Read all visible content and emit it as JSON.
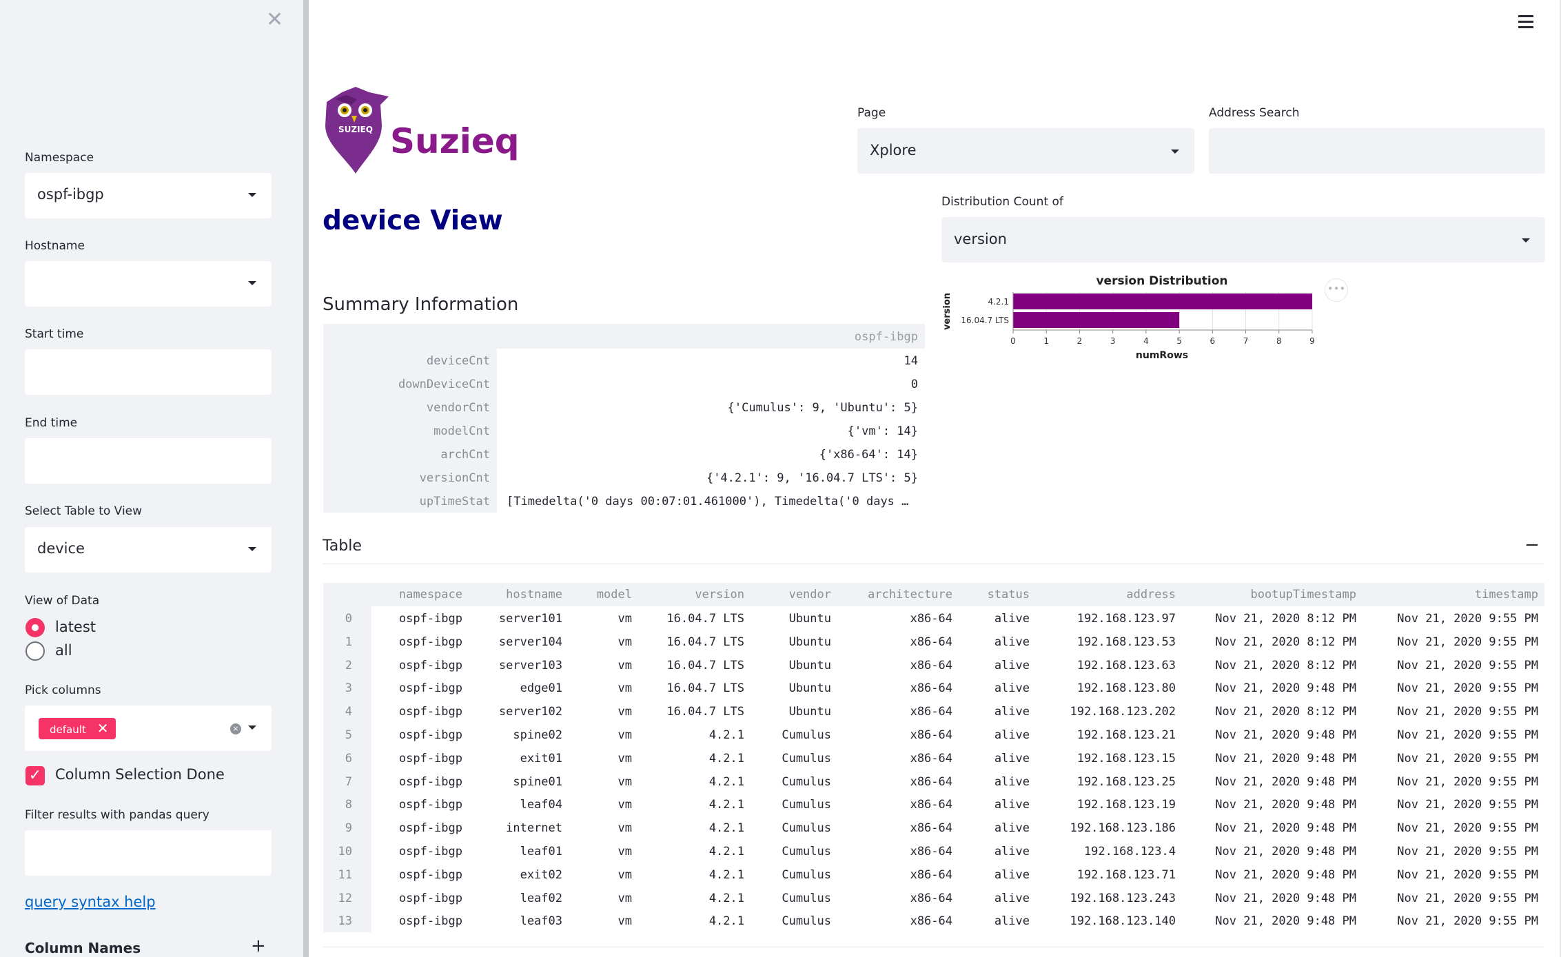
{
  "sidebar": {
    "namespace": {
      "label": "Namespace",
      "value": "ospf-ibgp"
    },
    "hostname": {
      "label": "Hostname",
      "value": ""
    },
    "start_time": {
      "label": "Start time",
      "value": ""
    },
    "end_time": {
      "label": "End time",
      "value": ""
    },
    "table_select": {
      "label": "Select Table to View",
      "value": "device"
    },
    "view_of_data": {
      "label": "View of Data",
      "options": [
        "latest",
        "all"
      ],
      "selected": "latest"
    },
    "pick_columns": {
      "label": "Pick columns",
      "tag": "default",
      "tag_close": "✕"
    },
    "column_selection_done": {
      "label": "Column Selection Done",
      "checked": true
    },
    "filter": {
      "label": "Filter results with pandas query",
      "value": ""
    },
    "query_help": "query syntax help",
    "column_names": {
      "label": "Column Names",
      "toggle": "+"
    }
  },
  "header": {
    "logo_text": "Suzieq",
    "logo_badge": "SUZIEQ",
    "page": {
      "label": "Page",
      "value": "Xplore"
    },
    "address_search": {
      "label": "Address Search",
      "value": ""
    }
  },
  "main": {
    "title": "device View",
    "distribution": {
      "label": "Distribution Count of",
      "value": "version"
    },
    "summary": {
      "heading": "Summary Information",
      "namespace": "ospf-ibgp",
      "rows": [
        {
          "key": "deviceCnt",
          "value": "14"
        },
        {
          "key": "downDeviceCnt",
          "value": "0"
        },
        {
          "key": "vendorCnt",
          "value": "{'Cumulus': 9, 'Ubuntu': 5}"
        },
        {
          "key": "modelCnt",
          "value": "{'vm': 14}"
        },
        {
          "key": "archCnt",
          "value": "{'x86-64': 14}"
        },
        {
          "key": "versionCnt",
          "value": "{'4.2.1': 9, '16.04.7 LTS': 5}"
        },
        {
          "key": "upTimeStat",
          "value": "[Timedelta('0 days 00:07:01.461000'), Timedelta('0 days …"
        }
      ]
    },
    "table": {
      "heading": "Table",
      "collapse": "−",
      "columns": [
        "namespace",
        "hostname",
        "model",
        "version",
        "vendor",
        "architecture",
        "status",
        "address",
        "bootupTimestamp",
        "timestamp"
      ],
      "rows": [
        [
          "0",
          "ospf-ibgp",
          "server101",
          "vm",
          "16.04.7 LTS",
          "Ubuntu",
          "x86-64",
          "alive",
          "192.168.123.97",
          "Nov 21, 2020 8:12 PM",
          "Nov 21, 2020 9:55 PM"
        ],
        [
          "1",
          "ospf-ibgp",
          "server104",
          "vm",
          "16.04.7 LTS",
          "Ubuntu",
          "x86-64",
          "alive",
          "192.168.123.53",
          "Nov 21, 2020 8:12 PM",
          "Nov 21, 2020 9:55 PM"
        ],
        [
          "2",
          "ospf-ibgp",
          "server103",
          "vm",
          "16.04.7 LTS",
          "Ubuntu",
          "x86-64",
          "alive",
          "192.168.123.63",
          "Nov 21, 2020 8:12 PM",
          "Nov 21, 2020 9:55 PM"
        ],
        [
          "3",
          "ospf-ibgp",
          "edge01",
          "vm",
          "16.04.7 LTS",
          "Ubuntu",
          "x86-64",
          "alive",
          "192.168.123.80",
          "Nov 21, 2020 9:48 PM",
          "Nov 21, 2020 9:55 PM"
        ],
        [
          "4",
          "ospf-ibgp",
          "server102",
          "vm",
          "16.04.7 LTS",
          "Ubuntu",
          "x86-64",
          "alive",
          "192.168.123.202",
          "Nov 21, 2020 8:12 PM",
          "Nov 21, 2020 9:55 PM"
        ],
        [
          "5",
          "ospf-ibgp",
          "spine02",
          "vm",
          "4.2.1",
          "Cumulus",
          "x86-64",
          "alive",
          "192.168.123.21",
          "Nov 21, 2020 9:48 PM",
          "Nov 21, 2020 9:55 PM"
        ],
        [
          "6",
          "ospf-ibgp",
          "exit01",
          "vm",
          "4.2.1",
          "Cumulus",
          "x86-64",
          "alive",
          "192.168.123.15",
          "Nov 21, 2020 9:48 PM",
          "Nov 21, 2020 9:55 PM"
        ],
        [
          "7",
          "ospf-ibgp",
          "spine01",
          "vm",
          "4.2.1",
          "Cumulus",
          "x86-64",
          "alive",
          "192.168.123.25",
          "Nov 21, 2020 9:48 PM",
          "Nov 21, 2020 9:55 PM"
        ],
        [
          "8",
          "ospf-ibgp",
          "leaf04",
          "vm",
          "4.2.1",
          "Cumulus",
          "x86-64",
          "alive",
          "192.168.123.19",
          "Nov 21, 2020 9:48 PM",
          "Nov 21, 2020 9:55 PM"
        ],
        [
          "9",
          "ospf-ibgp",
          "internet",
          "vm",
          "4.2.1",
          "Cumulus",
          "x86-64",
          "alive",
          "192.168.123.186",
          "Nov 21, 2020 9:48 PM",
          "Nov 21, 2020 9:55 PM"
        ],
        [
          "10",
          "ospf-ibgp",
          "leaf01",
          "vm",
          "4.2.1",
          "Cumulus",
          "x86-64",
          "alive",
          "192.168.123.4",
          "Nov 21, 2020 9:48 PM",
          "Nov 21, 2020 9:55 PM"
        ],
        [
          "11",
          "ospf-ibgp",
          "exit02",
          "vm",
          "4.2.1",
          "Cumulus",
          "x86-64",
          "alive",
          "192.168.123.71",
          "Nov 21, 2020 9:48 PM",
          "Nov 21, 2020 9:55 PM"
        ],
        [
          "12",
          "ospf-ibgp",
          "leaf02",
          "vm",
          "4.2.1",
          "Cumulus",
          "x86-64",
          "alive",
          "192.168.123.243",
          "Nov 21, 2020 9:48 PM",
          "Nov 21, 2020 9:55 PM"
        ],
        [
          "13",
          "ospf-ibgp",
          "leaf03",
          "vm",
          "4.2.1",
          "Cumulus",
          "x86-64",
          "alive",
          "192.168.123.140",
          "Nov 21, 2020 9:48 PM",
          "Nov 21, 2020 9:55 PM"
        ]
      ]
    }
  },
  "chart_data": {
    "type": "bar",
    "title": "version Distribution",
    "xlabel": "numRows",
    "ylabel": "version",
    "categories": [
      "4.2.1",
      "16.04.7 LTS"
    ],
    "values": [
      9,
      5
    ],
    "xlim": [
      0,
      9
    ],
    "xticks": [
      "0",
      "1",
      "2",
      "3",
      "4",
      "5",
      "6",
      "7",
      "8",
      "9"
    ],
    "color": "#800080",
    "orientation": "horizontal"
  },
  "colors": {
    "accent": "#f63366",
    "title": "#000080",
    "logo": "#8a1a8a",
    "sidebar_bg": "#f0f2f6",
    "link": "#0068c9"
  },
  "icons": {
    "close": "close-icon",
    "menu": "hamburger-menu-icon",
    "caret": "chevron-down-icon",
    "more": "more-options-icon"
  }
}
